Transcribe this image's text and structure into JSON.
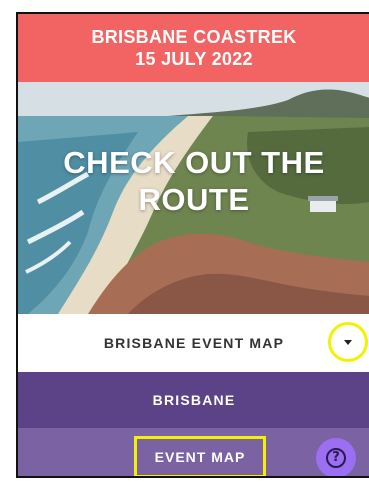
{
  "header": {
    "event_name": "BRISBANE COASTREK",
    "event_date": "15 JULY 2022"
  },
  "hero": {
    "title": "CHECK OUT THE ROUTE"
  },
  "map_selector": {
    "selected": "BRISBANE EVENT MAP",
    "toggle_icon": "caret-down-icon",
    "highlight_color": "#f2f200"
  },
  "region": {
    "label": "BRISBANE"
  },
  "tabs": {
    "event_map_label": "EVENT MAP"
  },
  "help": {
    "icon": "question-mark-icon",
    "glyph": "?"
  },
  "colors": {
    "header": "#f26464",
    "region_bar": "#5c4287",
    "tab_bar": "#7a62a3",
    "help_button": "#9b6ef2"
  }
}
